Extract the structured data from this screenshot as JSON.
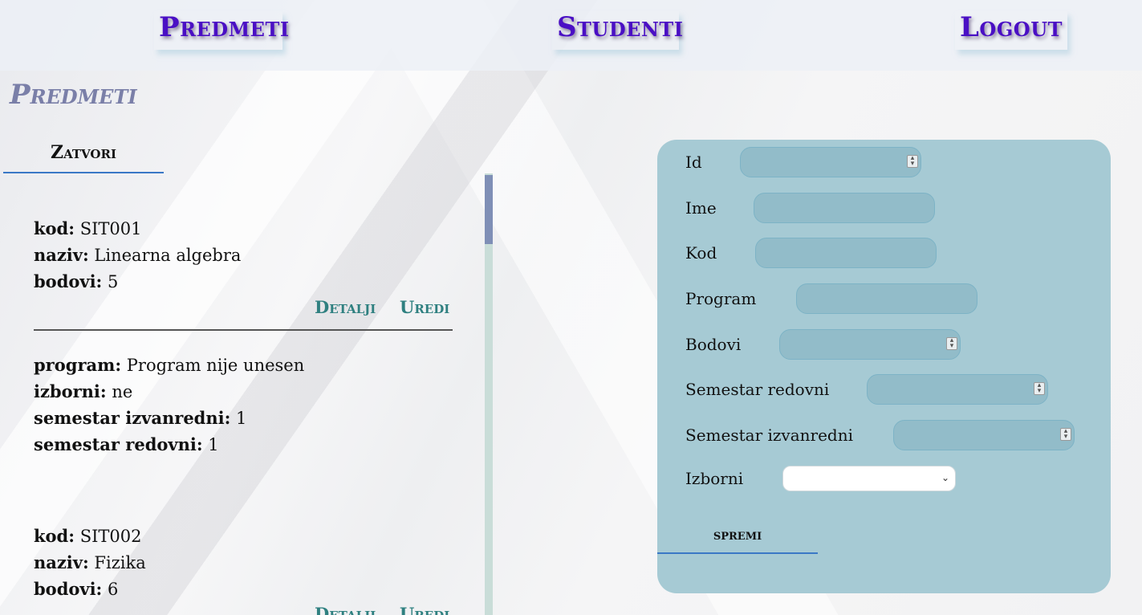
{
  "nav": {
    "predmeti": "Predmeti",
    "studenti": "Studenti",
    "logout": "Logout"
  },
  "page": {
    "title": "Predmeti",
    "close_label": "Zatvori"
  },
  "courses": [
    {
      "kod_label": "kod:",
      "kod": "SIT001",
      "naziv_label": "naziv:",
      "naziv": "Linearna algebra",
      "bodovi_label": "bodovi:",
      "bodovi": "5",
      "details_label": "Detalji",
      "edit_label": "Uredi",
      "program_label": "program:",
      "program": "Program nije unesen",
      "izborni_label": "izborni:",
      "izborni": "ne",
      "sem_izv_label": "semestar izvanredni:",
      "sem_izv": "1",
      "sem_red_label": "semestar redovni:",
      "sem_red": "1"
    },
    {
      "kod_label": "kod:",
      "kod": "SIT002",
      "naziv_label": "naziv:",
      "naziv": "Fizika",
      "bodovi_label": "bodovi:",
      "bodovi": "6",
      "details_label": "Detalji",
      "edit_label": "Uredi"
    }
  ],
  "form": {
    "id_label": "Id",
    "ime_label": "Ime",
    "kod_label": "Kod",
    "program_label": "Program",
    "bodovi_label": "Bodovi",
    "sem_red_label": "Semestar redovni",
    "sem_izv_label": "Semestar izvanredni",
    "izborni_label": "Izborni",
    "id_value": "",
    "ime_value": "",
    "kod_value": "",
    "program_value": "",
    "bodovi_value": "",
    "sem_red_value": "",
    "sem_izv_value": "",
    "izborni_selected": "",
    "save_label": "spremi"
  },
  "colors": {
    "nav_link": "#4a0fc4",
    "title": "#7a7fa8",
    "action_link": "#2f8080",
    "form_bg": "#a6cad4",
    "input_bg": "#92bcc9",
    "underline": "#3a78c6"
  }
}
